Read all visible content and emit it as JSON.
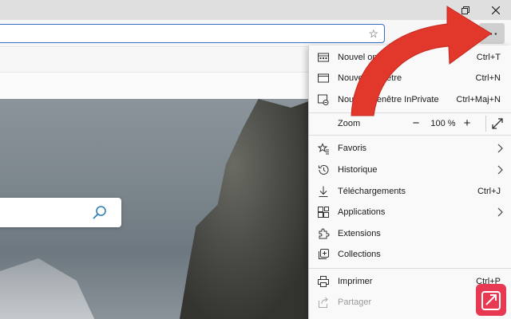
{
  "window": {
    "restore_icon": "restore-icon",
    "close_icon": "close-icon"
  },
  "toolbar": {
    "favorite_icon": "star-icon",
    "more_label": "···"
  },
  "search": {
    "icon": "search-icon"
  },
  "menu": {
    "items": [
      {
        "label": "Nouvel onglet",
        "shortcut": "Ctrl+T",
        "icon": "new-tab-icon"
      },
      {
        "label": "Nouvelle fenêtre",
        "shortcut": "Ctrl+N",
        "icon": "window-icon"
      },
      {
        "label": "Nouvelle fenêtre InPrivate",
        "shortcut": "Ctrl+Maj+N",
        "icon": "inprivate-icon"
      }
    ],
    "zoom": {
      "label": "Zoom",
      "minus": "−",
      "value": "100 %",
      "plus": "+",
      "icon": "fullscreen-icon"
    },
    "items2": [
      {
        "label": "Favoris",
        "shortcut": "",
        "submenu": true,
        "icon": "favorites-icon"
      },
      {
        "label": "Historique",
        "shortcut": "",
        "submenu": true,
        "icon": "history-icon"
      },
      {
        "label": "Téléchargements",
        "shortcut": "Ctrl+J",
        "submenu": false,
        "icon": "download-icon"
      },
      {
        "label": "Applications",
        "shortcut": "",
        "submenu": true,
        "icon": "apps-icon"
      },
      {
        "label": "Extensions",
        "shortcut": "",
        "submenu": false,
        "icon": "extensions-icon"
      },
      {
        "label": "Collections",
        "shortcut": "",
        "submenu": false,
        "icon": "collections-icon"
      }
    ],
    "items3": [
      {
        "label": "Imprimer",
        "shortcut": "Ctrl+P",
        "icon": "print-icon"
      },
      {
        "label": "Partager",
        "shortcut": "",
        "icon": "share-icon",
        "disabled": true
      }
    ]
  },
  "colors": {
    "arrow": "#e2372b",
    "accent": "#3a6fc4",
    "badge": "#e73a52"
  }
}
